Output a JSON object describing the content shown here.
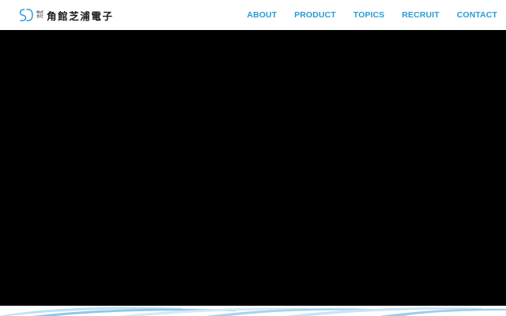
{
  "brand": {
    "mark": "SD",
    "company_type_top": "株式",
    "company_type_bottom": "会社",
    "name": "角館芝浦電子",
    "accent_color": "#2a9bd6"
  },
  "nav": {
    "items": [
      {
        "label": "ABOUT"
      },
      {
        "label": "PRODUCT"
      },
      {
        "label": "TOPICS"
      },
      {
        "label": "RECRUIT"
      },
      {
        "label": "CONTACT"
      }
    ]
  },
  "hero": {
    "background": "#000000"
  }
}
